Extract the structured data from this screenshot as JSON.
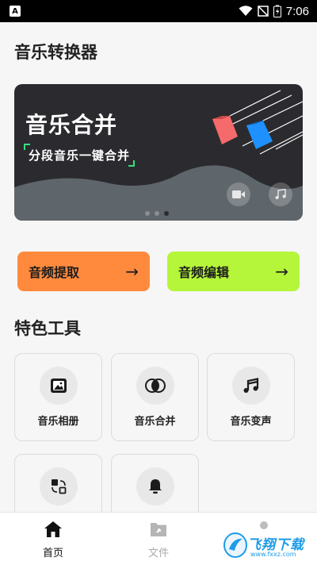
{
  "status_bar": {
    "app_icon_letter": "A",
    "time": "7:06"
  },
  "app_title": "音乐转换器",
  "banner": {
    "title": "音乐合并",
    "subtitle": "分段音乐一键合并",
    "slide_count": 3,
    "active_slide": 3
  },
  "actions": {
    "extract_label": "音频提取",
    "edit_label": "音频编辑",
    "arrow": "→"
  },
  "section_title": "特色工具",
  "tools": [
    {
      "label": "音乐相册",
      "icon": "photo-album-icon"
    },
    {
      "label": "音乐合并",
      "icon": "merge-circles-icon"
    },
    {
      "label": "音乐变声",
      "icon": "music-note-icon"
    },
    {
      "label": "",
      "icon": "convert-icon"
    },
    {
      "label": "",
      "icon": "bell-icon"
    }
  ],
  "bottom_nav": {
    "home_label": "首页",
    "files_label": "文件"
  },
  "watermark": {
    "text": "飞翔下载",
    "sub": "www.fxxz.com"
  },
  "colors": {
    "extract_bg": "#ff8a3d",
    "edit_bg": "#b5f53a",
    "banner_bg": "#2b2b2f",
    "bar_red": "#f56a6a",
    "bar_blue": "#1e90ff"
  }
}
